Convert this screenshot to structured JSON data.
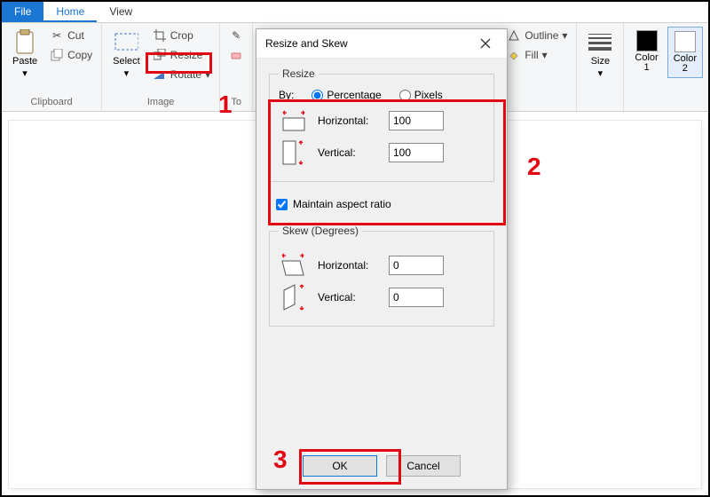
{
  "tabs": {
    "file": "File",
    "home": "Home",
    "view": "View"
  },
  "ribbon": {
    "clipboard": {
      "label": "Clipboard",
      "paste": "Paste",
      "cut": "Cut",
      "copy": "Copy"
    },
    "image": {
      "label": "Image",
      "select": "Select",
      "crop": "Crop",
      "resize": "Resize",
      "rotate": "Rotate"
    },
    "tools_label_partial": "To",
    "shapes": {
      "outline": "Outline",
      "fill": "Fill"
    },
    "size": "Size",
    "color1": "Color\n1",
    "color2": "Color\n2"
  },
  "dialog": {
    "title": "Resize and Skew",
    "resize": {
      "legend": "Resize",
      "by": "By:",
      "percentage": "Percentage",
      "pixels": "Pixels",
      "horizontal": "Horizontal:",
      "vertical": "Vertical:",
      "h_val": "100",
      "v_val": "100",
      "maintain": "Maintain aspect ratio"
    },
    "skew": {
      "legend": "Skew (Degrees)",
      "horizontal": "Horizontal:",
      "vertical": "Vertical:",
      "h_val": "0",
      "v_val": "0"
    },
    "ok": "OK",
    "cancel": "Cancel"
  },
  "annotations": {
    "one": "1",
    "two": "2",
    "three": "3"
  }
}
